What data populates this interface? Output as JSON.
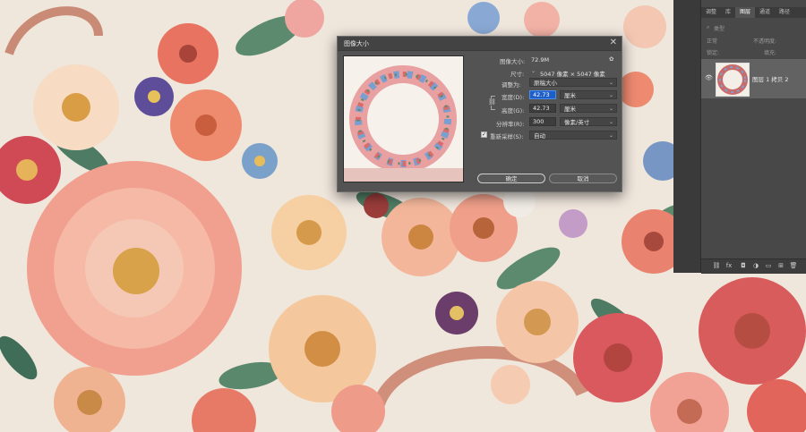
{
  "dialog": {
    "title": "图像大小",
    "close_glyph": "✕",
    "image_size_label": "图像大小:",
    "image_size_value": "72.9M",
    "gear_glyph": "✿",
    "dimensions_label": "尺寸:",
    "dimensions_value": "5047 像素 × 5047 像素",
    "fit_label": "调整为:",
    "fit_value": "原稿大小",
    "width_label": "宽度(D):",
    "width_value": "42.73",
    "width_unit": "厘米",
    "height_label": "高度(G):",
    "height_value": "42.73",
    "height_unit": "厘米",
    "resolution_label": "分辨率(R):",
    "resolution_value": "300",
    "resolution_unit": "像素/英寸",
    "resample_label": "重新采样(S):",
    "resample_value": "自动",
    "resample_checked": "✓",
    "ok_label": "确定",
    "cancel_label": "取消"
  },
  "panel": {
    "tabs": [
      "调整",
      "库",
      "图层",
      "通道",
      "路径"
    ],
    "search_placeholder": "类型",
    "blend_mode": "正常",
    "opacity_label": "不透明度:",
    "lock_label": "锁定:",
    "fill_label": "填充:",
    "layer_name": "图层 1 拷贝 2",
    "bottom_icons": [
      "link-icon",
      "fx-icon",
      "mask-icon",
      "adjustment-icon",
      "folder-icon",
      "new-layer-icon",
      "trash-icon"
    ],
    "bottom_glyphs": [
      "⛓",
      "fx",
      "◘",
      "◑",
      "▭",
      "⊞",
      "🗑"
    ]
  },
  "colors": {
    "dialog_bg": "#535353",
    "active_field": "#1e5ec8",
    "panel_bg": "#484848"
  }
}
